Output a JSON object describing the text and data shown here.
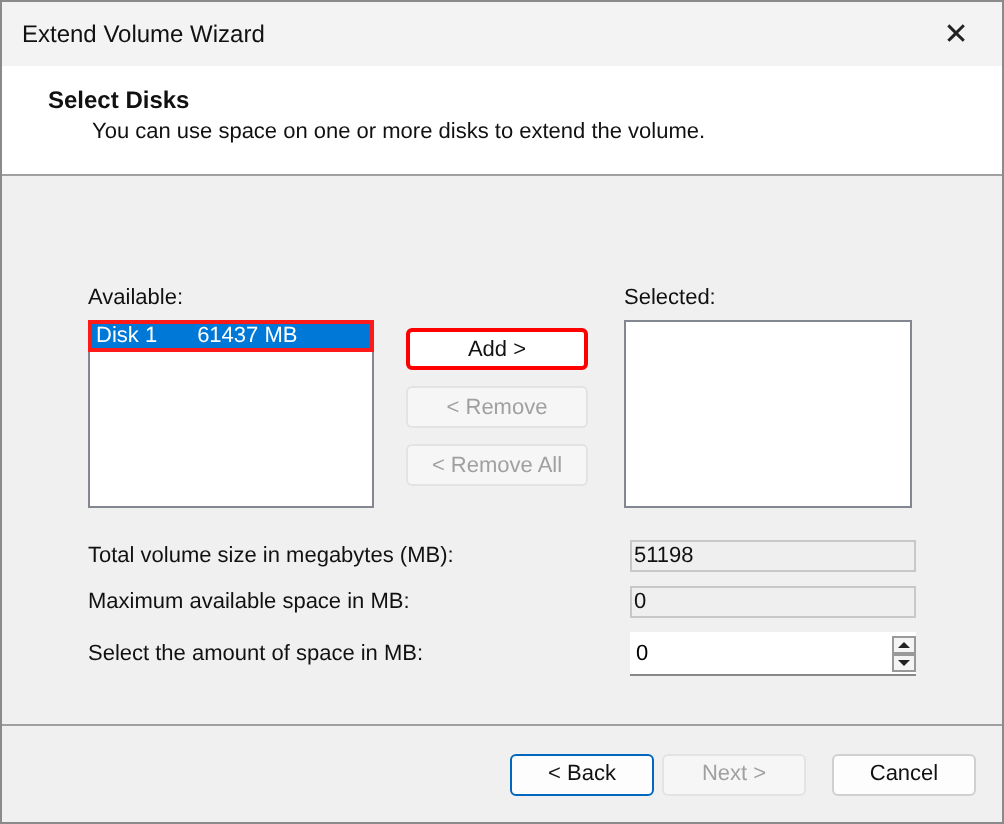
{
  "window": {
    "title": "Extend Volume Wizard",
    "close": "✕"
  },
  "header": {
    "title": "Select Disks",
    "subtitle": "You can use space on one or more disks to extend the volume."
  },
  "available": {
    "label": "Available:",
    "items": [
      {
        "label": "Disk 1",
        "size": "61437 MB",
        "selected": true,
        "highlighted": true
      }
    ]
  },
  "move_buttons": [
    {
      "label": "Add >",
      "disabled": false,
      "highlighted": true
    },
    {
      "label": "< Remove",
      "disabled": true,
      "highlighted": false
    },
    {
      "label": "< Remove All",
      "disabled": true,
      "highlighted": false
    }
  ],
  "selected": {
    "label": "Selected:"
  },
  "fields": [
    {
      "kind": "readonly",
      "label": "Total volume size in megabytes (MB):",
      "value": "51198"
    },
    {
      "kind": "readonly",
      "label": "Maximum available space in MB:",
      "value": "0"
    },
    {
      "kind": "spinner",
      "label": "Select the amount of space in MB:",
      "value": "0"
    }
  ],
  "buttons": [
    {
      "label": "< Back",
      "disabled": false,
      "default": true
    },
    {
      "label": "Next >",
      "disabled": true,
      "default": false
    },
    {
      "label": "Cancel",
      "disabled": false,
      "default": false
    }
  ]
}
